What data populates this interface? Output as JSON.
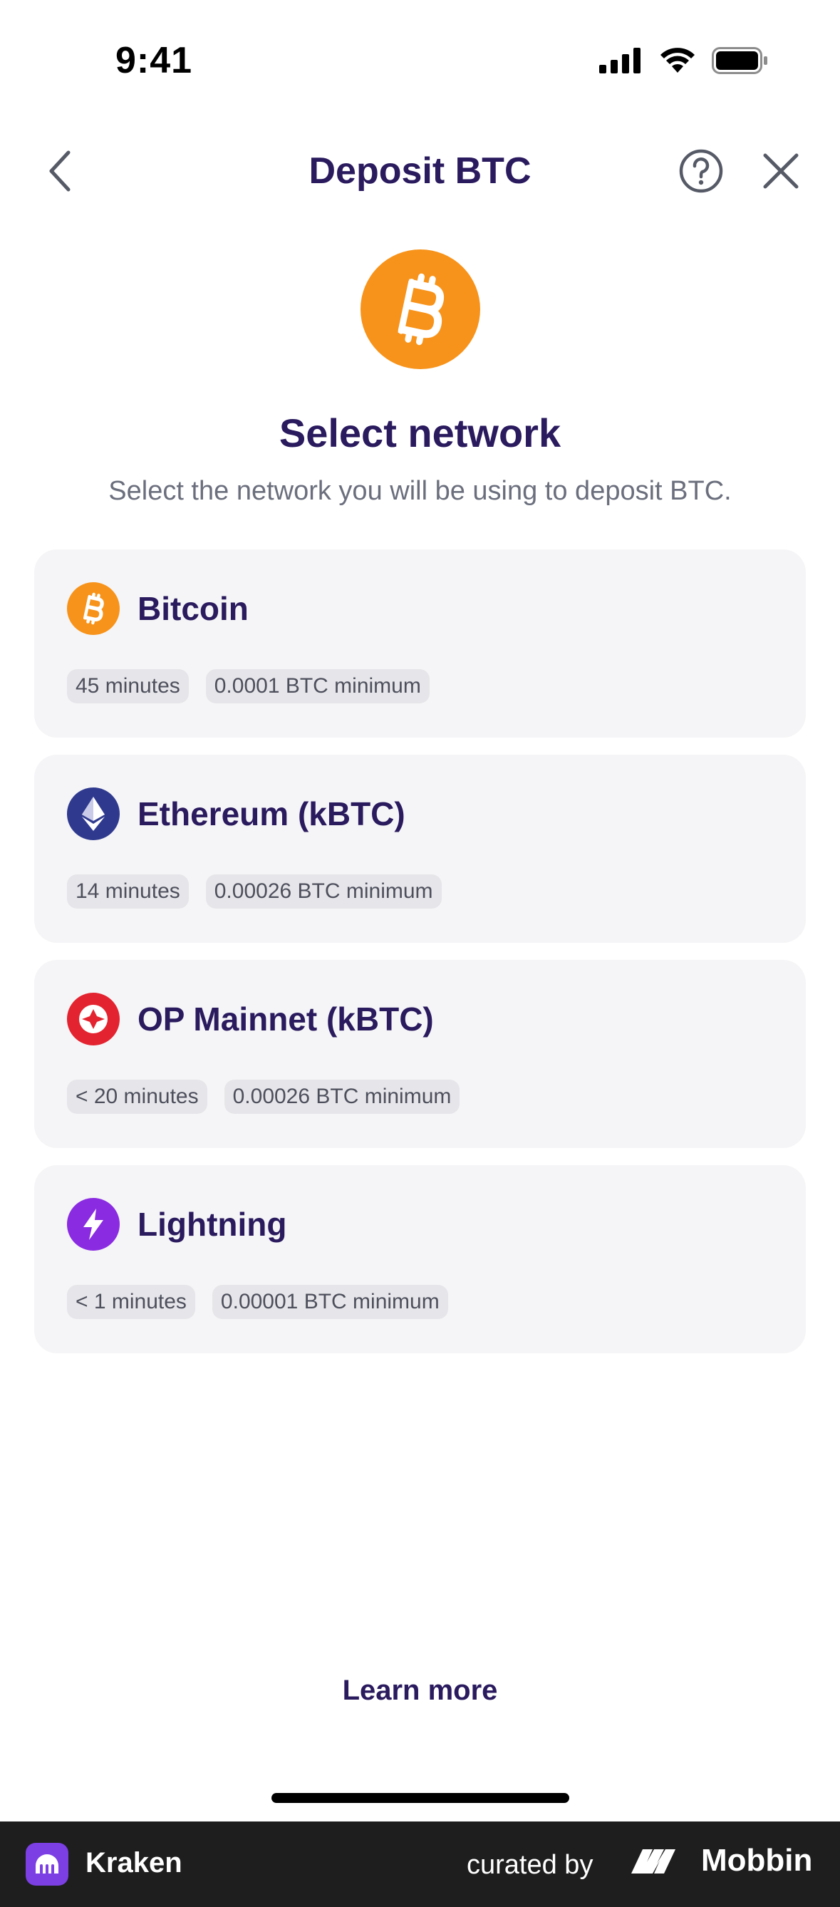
{
  "status_bar": {
    "time": "9:41"
  },
  "nav": {
    "title": "Deposit BTC"
  },
  "header": {
    "headline": "Select network",
    "subtitle": "Select the network you will be using to deposit BTC."
  },
  "networks": [
    {
      "name": "Bitcoin",
      "icon": "bitcoin-icon",
      "color": "#f7931a",
      "time": "45 minutes",
      "minimum": "0.0001 BTC minimum"
    },
    {
      "name": "Ethereum (kBTC)",
      "icon": "ethereum-icon",
      "color": "#2f3a8f",
      "time": "14 minutes",
      "minimum": "0.00026 BTC minimum"
    },
    {
      "name": "OP Mainnet (kBTC)",
      "icon": "optimism-icon",
      "color": "#e3232f",
      "time": "< 20 minutes",
      "minimum": "0.00026 BTC minimum"
    },
    {
      "name": "Lightning",
      "icon": "lightning-icon",
      "color": "#8a2be2",
      "time": "< 1 minutes",
      "minimum": "0.00001 BTC minimum"
    }
  ],
  "learn_more": "Learn more",
  "footer": {
    "app_name": "Kraken",
    "curated_by": "curated by",
    "brand": "Mobbin"
  }
}
